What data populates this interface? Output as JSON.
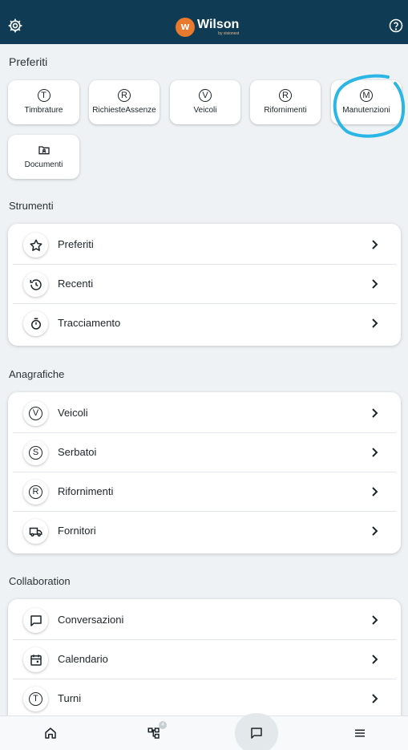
{
  "header": {
    "logo_name": "Wilson",
    "logo_mark": "W",
    "logo_by": "by visionest",
    "settings_icon": "gear-icon",
    "help_icon": "help-circle-icon"
  },
  "favorites": {
    "title": "Preferiti",
    "items": [
      {
        "icon": "T",
        "label": "Timbrature"
      },
      {
        "icon": "R",
        "label": "RichiesteAssenze"
      },
      {
        "icon": "V",
        "label": "Veicoli"
      },
      {
        "icon": "R",
        "label": "Rifornimenti"
      },
      {
        "icon": "M",
        "label": "Manutenzioni"
      },
      {
        "icon": "folder-user-icon",
        "label": "Documenti"
      }
    ]
  },
  "tools": {
    "title": "Strumenti",
    "items": [
      {
        "icon": "star-icon",
        "label": "Preferiti"
      },
      {
        "icon": "history-icon",
        "label": "Recenti"
      },
      {
        "icon": "timer-icon",
        "label": "Tracciamento"
      }
    ]
  },
  "registry": {
    "title": "Anagrafiche",
    "items": [
      {
        "icon": "V",
        "label": "Veicoli"
      },
      {
        "icon": "S",
        "label": "Serbatoi"
      },
      {
        "icon": "R",
        "label": "Rifornimenti"
      },
      {
        "icon": "truck-icon",
        "label": "Fornitori"
      }
    ]
  },
  "collaboration": {
    "title": "Collaboration",
    "items": [
      {
        "icon": "chat-icon",
        "label": "Conversazioni"
      },
      {
        "icon": "calendar-icon",
        "label": "Calendario"
      },
      {
        "icon": "T",
        "label": "Turni"
      }
    ]
  },
  "bottom_nav": {
    "items": [
      "home-icon",
      "hierarchy-icon",
      "chat-icon",
      "menu-icon"
    ],
    "badge": "4"
  },
  "colors": {
    "header_bg": "#0f3c54",
    "accent": "#e8792d",
    "annotation": "#2bb6e6"
  }
}
